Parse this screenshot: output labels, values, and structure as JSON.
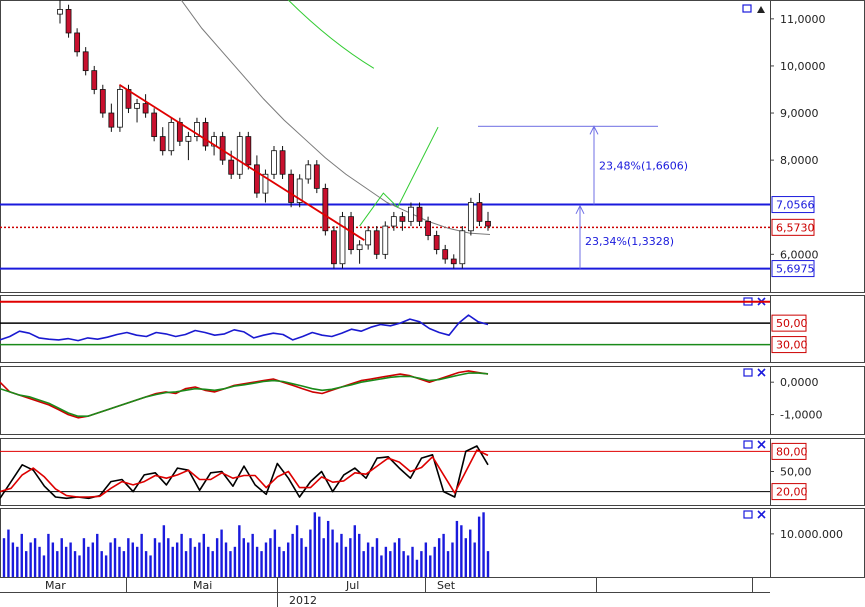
{
  "chart_data": {
    "type": "candlestick",
    "x_labels": [
      "Mar",
      "Mai",
      "Jul",
      "Set"
    ],
    "year_label": "2012",
    "panels": [
      {
        "id": "price",
        "ticks": [
          "11,0000",
          "10,0000",
          "9,0000",
          "8,0000",
          "6,0000"
        ],
        "ylim": [
          5.2,
          11.4
        ],
        "levels": [
          {
            "label": "7,0566",
            "value": 7.0566,
            "style": "solid",
            "color": "#1a1adc"
          },
          {
            "label": "6,5730",
            "value": 6.573,
            "style": "dotted",
            "color": "#cc0000"
          },
          {
            "label": "5,6975",
            "value": 5.6975,
            "style": "solid",
            "color": "#1a1adc"
          }
        ],
        "annotations": [
          {
            "label": "23,48%(1,6606)",
            "from": 7.0566,
            "to": 8.7172
          },
          {
            "label": "23,34%(1,3328)",
            "from": 5.6975,
            "to": 7.0303
          }
        ],
        "trendline": {
          "color": "#e00000",
          "start": [
            2.5,
            9.6
          ],
          "end": [
            12.8,
            6.3
          ]
        },
        "moving_average": {
          "color": "#7a7a7a",
          "values": [
            12.5,
            12.0,
            11.4,
            10.8,
            10.3,
            9.8,
            9.3,
            8.85,
            8.45,
            8.05,
            7.7,
            7.4,
            7.1,
            6.9,
            6.7,
            6.55,
            6.45,
            6.42
          ]
        },
        "projection": {
          "color": "#33cc33",
          "values": [
            [
              12.6,
              6.6
            ],
            [
              13.6,
              7.3
            ],
            [
              14.2,
              7.0
            ],
            [
              15.9,
              8.7
            ]
          ]
        },
        "long_average": {
          "color": "#33cc33",
          "values": [
            [
              9.6,
              11.4
            ],
            [
              13.2,
              9.95
            ]
          ]
        },
        "ohlc": [
          [
            11.1,
            11.4,
            10.9,
            11.2
          ],
          [
            11.2,
            11.3,
            10.6,
            10.7
          ],
          [
            10.7,
            10.8,
            10.2,
            10.3
          ],
          [
            10.3,
            10.4,
            9.8,
            9.9
          ],
          [
            9.9,
            10.0,
            9.4,
            9.5
          ],
          [
            9.5,
            9.6,
            8.9,
            9.0
          ],
          [
            9.0,
            9.2,
            8.6,
            8.7
          ],
          [
            8.7,
            9.6,
            8.6,
            9.5
          ],
          [
            9.5,
            9.6,
            9.0,
            9.1
          ],
          [
            9.1,
            9.3,
            8.8,
            9.2
          ],
          [
            9.2,
            9.4,
            8.9,
            9.0
          ],
          [
            9.0,
            9.1,
            8.4,
            8.5
          ],
          [
            8.5,
            8.7,
            8.1,
            8.2
          ],
          [
            8.2,
            8.9,
            8.1,
            8.8
          ],
          [
            8.8,
            8.9,
            8.3,
            8.4
          ],
          [
            8.4,
            8.6,
            8.0,
            8.5
          ],
          [
            8.5,
            8.9,
            8.4,
            8.8
          ],
          [
            8.8,
            8.9,
            8.2,
            8.3
          ],
          [
            8.3,
            8.6,
            8.1,
            8.5
          ],
          [
            8.5,
            8.6,
            7.9,
            8.0
          ],
          [
            8.0,
            8.2,
            7.6,
            7.7
          ],
          [
            7.7,
            8.6,
            7.6,
            8.5
          ],
          [
            8.5,
            8.6,
            7.8,
            7.9
          ],
          [
            7.9,
            8.1,
            7.2,
            7.3
          ],
          [
            7.3,
            7.8,
            7.1,
            7.7
          ],
          [
            7.7,
            8.3,
            7.6,
            8.2
          ],
          [
            8.2,
            8.3,
            7.6,
            7.7
          ],
          [
            7.7,
            7.8,
            7.0,
            7.1
          ],
          [
            7.1,
            7.7,
            7.0,
            7.6
          ],
          [
            7.6,
            8.0,
            7.5,
            7.9
          ],
          [
            7.9,
            8.0,
            7.3,
            7.4
          ],
          [
            7.4,
            7.5,
            6.4,
            6.5
          ],
          [
            6.5,
            6.6,
            5.7,
            5.8
          ],
          [
            5.8,
            6.9,
            5.7,
            6.8
          ],
          [
            6.8,
            6.9,
            6.0,
            6.1
          ],
          [
            6.1,
            6.3,
            5.8,
            6.2
          ],
          [
            6.2,
            6.6,
            6.1,
            6.5
          ],
          [
            6.5,
            6.6,
            5.9,
            6.0
          ],
          [
            6.0,
            6.7,
            5.9,
            6.6
          ],
          [
            6.6,
            6.9,
            6.5,
            6.8
          ],
          [
            6.8,
            6.9,
            6.5,
            6.7
          ],
          [
            6.7,
            7.1,
            6.6,
            7.0
          ],
          [
            7.0,
            7.1,
            6.6,
            6.7
          ],
          [
            6.7,
            6.8,
            6.3,
            6.4
          ],
          [
            6.4,
            6.5,
            6.0,
            6.1
          ],
          [
            6.1,
            6.2,
            5.8,
            5.9
          ],
          [
            5.9,
            6.0,
            5.7,
            5.8
          ],
          [
            5.8,
            6.6,
            5.7,
            6.5
          ],
          [
            6.5,
            7.2,
            6.4,
            7.1
          ],
          [
            7.1,
            7.3,
            6.6,
            6.7
          ],
          [
            6.7,
            6.9,
            6.5,
            6.6
          ]
        ]
      },
      {
        "id": "rsi",
        "ticks": [],
        "ylim": [
          0,
          100
        ],
        "level_labels": [
          "50,00",
          "30,00"
        ],
        "levels": [
          80,
          50,
          30
        ],
        "series": [
          {
            "color": "#1a1ad0",
            "values": [
              33,
              38,
              46,
              43,
              36,
              34,
              33,
              35,
              32,
              36,
              34,
              37,
              41,
              44,
              40,
              38,
              44,
              42,
              38,
              41,
              47,
              44,
              40,
              42,
              48,
              45,
              36,
              40,
              43,
              41,
              33,
              38,
              44,
              40,
              38,
              43,
              49,
              46,
              52,
              56,
              54,
              58,
              64,
              60,
              50,
              44,
              40,
              58,
              70,
              60,
              56
            ]
          }
        ]
      },
      {
        "id": "macd",
        "ticks": [
          "0,0000",
          "-1,0000"
        ],
        "ylim": [
          -1.6,
          0.5
        ],
        "series": [
          {
            "color": "#cc0000",
            "values": [
              0.0,
              -0.3,
              -0.4,
              -0.5,
              -0.6,
              -0.7,
              -0.85,
              -1.0,
              -1.1,
              -1.05,
              -0.95,
              -0.85,
              -0.75,
              -0.65,
              -0.55,
              -0.45,
              -0.35,
              -0.3,
              -0.35,
              -0.2,
              -0.15,
              -0.25,
              -0.3,
              -0.2,
              -0.1,
              -0.05,
              0.0,
              0.05,
              0.1,
              0.0,
              -0.1,
              -0.2,
              -0.3,
              -0.35,
              -0.25,
              -0.15,
              -0.05,
              0.05,
              0.1,
              0.15,
              0.2,
              0.25,
              0.2,
              0.1,
              0.0,
              0.1,
              0.2,
              0.3,
              0.35,
              0.3,
              0.25
            ]
          },
          {
            "color": "#1a8a1a",
            "values": [
              -0.2,
              -0.3,
              -0.4,
              -0.45,
              -0.55,
              -0.65,
              -0.8,
              -0.95,
              -1.05,
              -1.05,
              -0.95,
              -0.85,
              -0.75,
              -0.65,
              -0.55,
              -0.45,
              -0.38,
              -0.32,
              -0.3,
              -0.25,
              -0.2,
              -0.22,
              -0.25,
              -0.2,
              -0.12,
              -0.08,
              -0.03,
              0.02,
              0.05,
              0.02,
              -0.05,
              -0.12,
              -0.2,
              -0.25,
              -0.22,
              -0.15,
              -0.08,
              0.0,
              0.05,
              0.1,
              0.15,
              0.18,
              0.18,
              0.12,
              0.05,
              0.08,
              0.15,
              0.22,
              0.28,
              0.28,
              0.26
            ]
          }
        ]
      },
      {
        "id": "stochastic",
        "ticks": [
          "50,00"
        ],
        "ylim": [
          0,
          100
        ],
        "level_labels": [
          "80,00",
          "20,00"
        ],
        "levels": [
          80,
          20
        ],
        "series": [
          {
            "color": "#000000",
            "values": [
              10,
              35,
              60,
              52,
              28,
              12,
              10,
              12,
              10,
              14,
              35,
              38,
              20,
              45,
              48,
              30,
              55,
              52,
              22,
              48,
              50,
              28,
              58,
              30,
              16,
              62,
              40,
              12,
              35,
              50,
              20,
              45,
              55,
              40,
              70,
              72,
              55,
              40,
              70,
              75,
              20,
              12,
              80,
              88,
              60
            ]
          },
          {
            "color": "#dd0000",
            "values": [
              20,
              25,
              45,
              55,
              42,
              24,
              14,
              12,
              12,
              13,
              25,
              35,
              30,
              35,
              44,
              40,
              45,
              52,
              38,
              38,
              48,
              40,
              44,
              44,
              26,
              42,
              50,
              26,
              26,
              42,
              34,
              36,
              48,
              46,
              58,
              70,
              64,
              50,
              56,
              72,
              45,
              18,
              50,
              82,
              74
            ]
          }
        ]
      },
      {
        "id": "volume",
        "ticks": [
          "10.000.000"
        ],
        "ylim": [
          0,
          16000000
        ],
        "values": [
          9,
          11,
          8,
          7,
          10,
          6,
          8,
          9,
          7,
          5,
          10,
          8,
          6,
          9,
          7,
          8,
          6,
          5,
          9,
          7,
          8,
          10,
          6,
          5,
          8,
          9,
          7,
          6,
          9,
          8,
          7,
          10,
          6,
          5,
          9,
          8,
          12,
          9,
          7,
          8,
          10,
          6,
          9,
          7,
          8,
          10,
          7,
          6,
          9,
          11,
          8,
          6,
          7,
          12,
          9,
          8,
          10,
          7,
          6,
          8,
          9,
          11,
          7,
          6,
          8,
          10,
          12,
          9,
          7,
          11,
          15,
          14,
          9,
          13,
          11,
          8,
          10,
          7,
          9,
          12,
          10,
          6,
          8,
          7,
          9,
          5,
          7,
          6,
          8,
          9,
          6,
          5,
          7,
          4,
          6,
          8,
          5,
          7,
          9,
          10,
          6,
          8,
          13,
          12,
          9,
          11,
          8,
          14,
          15,
          6
        ]
      }
    ]
  }
}
